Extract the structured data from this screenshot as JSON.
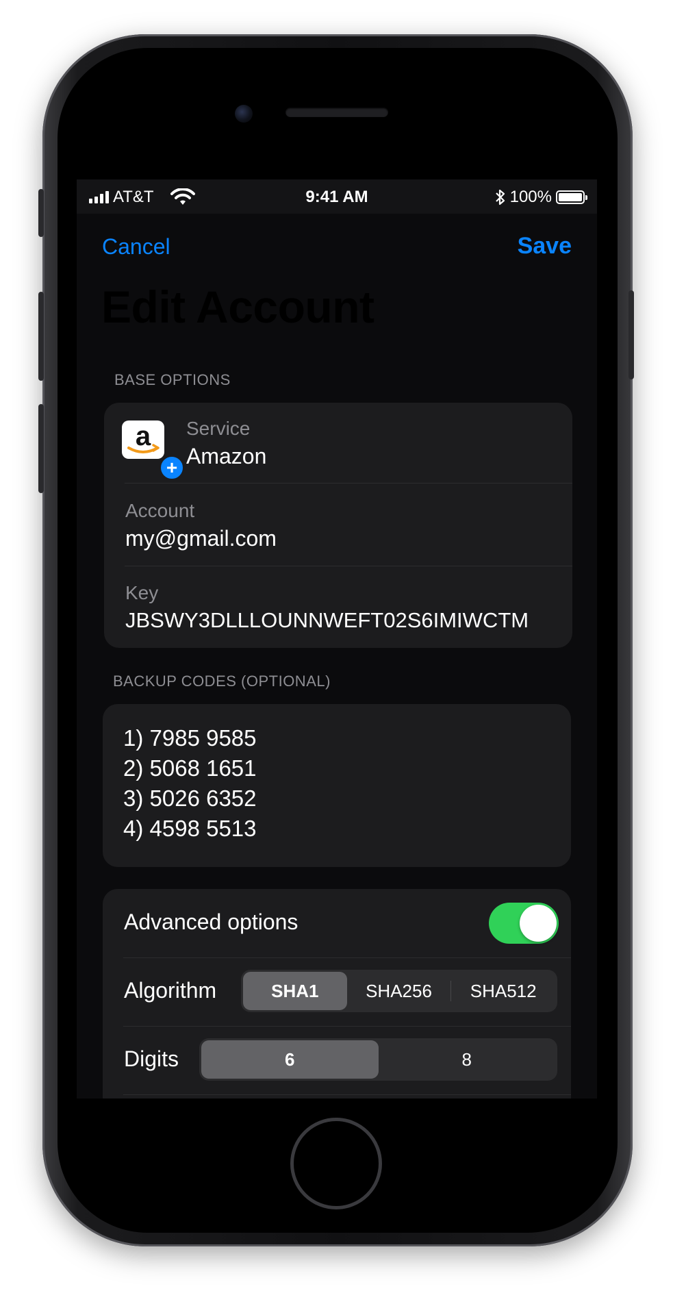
{
  "status_bar": {
    "carrier": "AT&T",
    "time": "9:41 AM",
    "battery": "100%",
    "signal_bars": 4
  },
  "nav": {
    "cancel_label": "Cancel",
    "save_label": "Save"
  },
  "title": "Edit Account",
  "base_options": {
    "header": "BASE OPTIONS",
    "service_label": "Service",
    "service_value": "Amazon",
    "service_icon": "amazon-logo",
    "account_label": "Account",
    "account_value": "my@gmail.com",
    "key_label": "Key",
    "key_value": "JBSWY3DLLLOUNNWEFT02S6IMIWCTM"
  },
  "backup_codes": {
    "header": "BACKUP CODES (OPTIONAL)",
    "codes": [
      "1) 7985 9585",
      "2) 5068 1651",
      "3) 5026 6352",
      "4) 4598 5513"
    ]
  },
  "advanced": {
    "toggle_label": "Advanced options",
    "toggle_on": true,
    "algorithm_label": "Algorithm",
    "algorithm_options": [
      "SHA1",
      "SHA256",
      "SHA512"
    ],
    "algorithm_selected": "SHA1",
    "digits_label": "Digits",
    "digits_options": [
      "6",
      "8"
    ],
    "digits_selected": "6"
  },
  "colors": {
    "accent": "#0a84ff",
    "toggle_on": "#30d158",
    "card": "#1c1c1e",
    "background": "#0b0b0d",
    "secondary_text": "#8e8e93"
  }
}
